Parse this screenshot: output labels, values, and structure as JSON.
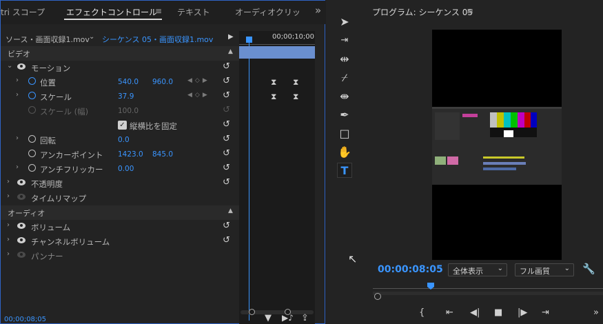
{
  "effects_panel": {
    "tabs": [
      "tri スコープ",
      "エフェクトコントロール",
      "テキスト",
      "オーディオクリップ"
    ],
    "tab_menu_glyph": "≡",
    "overflow_glyph": "»",
    "source_label": "ソース・画面収録1.mov",
    "sequence_label": "シーケンス 05・画面収録1.mov",
    "ruler_time": "00;00;10;00",
    "video_header": "ビデオ",
    "audio_header": "オーディオ",
    "rows": {
      "motion": "モーション",
      "position": "位置",
      "position_x": "540.0",
      "position_y": "960.0",
      "scale": "スケール",
      "scale_value": "37.9",
      "scale_width": "スケール (幅)",
      "scale_width_value": "100.0",
      "uniform_scale": "縦横比を固定",
      "rotation": "回転",
      "rotation_value": "0.0",
      "anchor": "アンカーポイント",
      "anchor_x": "1423.0",
      "anchor_y": "845.0",
      "antiflicker": "アンチフリッカー",
      "antiflicker_value": "0.00",
      "opacity": "不透明度",
      "time_remap": "タイムリマップ",
      "volume": "ボリューム",
      "channel_volume": "チャンネルボリューム",
      "panner": "パンナー"
    },
    "footer_time": "00;00;08;05"
  },
  "program_monitor": {
    "title": "プログラム: シーケンス 05",
    "timecode": "00:00:08:05",
    "zoom_select": "全体表示",
    "quality_select": "フル画質"
  },
  "colors": {
    "accent": "#3a95ff",
    "panel_border": "#2f64c7"
  }
}
